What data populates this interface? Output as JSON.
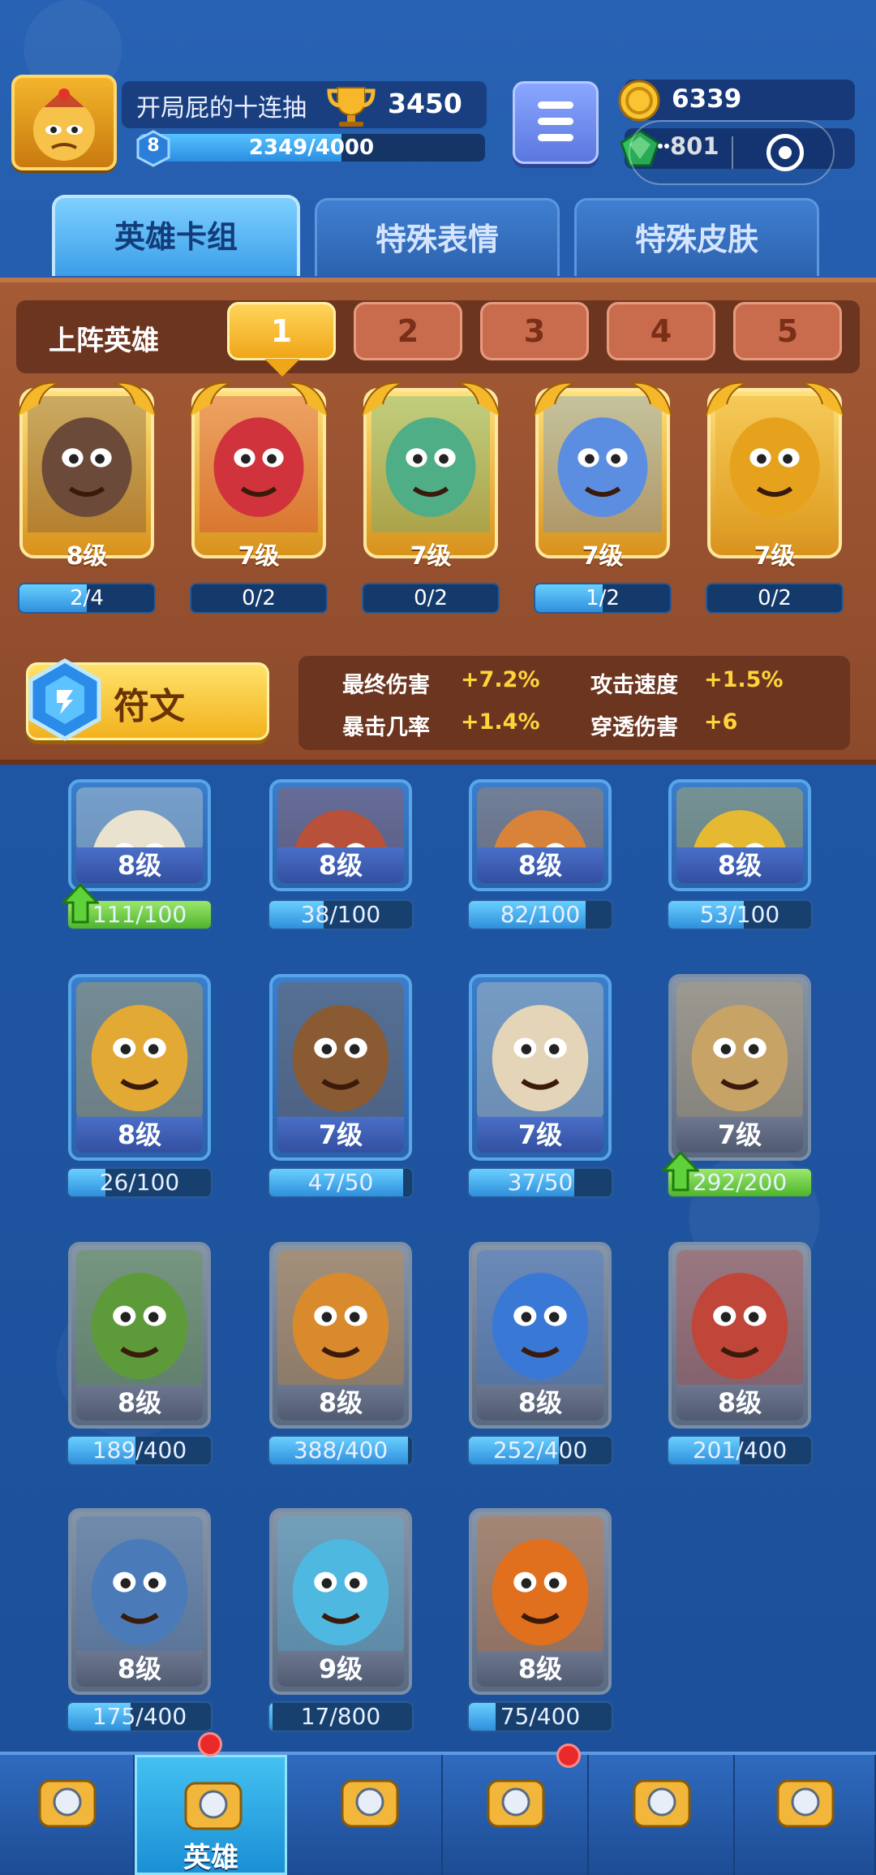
{
  "player": {
    "name": "开局屁的十连抽",
    "trophies": "3450",
    "level": "8",
    "xp_text": "2349/4000",
    "xp_fraction": 0.587
  },
  "currency": {
    "gold": "6339",
    "gems": "801"
  },
  "tabs": [
    {
      "label": "英雄卡组",
      "active": true
    },
    {
      "label": "特殊表情",
      "active": false
    },
    {
      "label": "特殊皮肤",
      "active": false
    }
  ],
  "deck": {
    "label": "上阵英雄",
    "slots": [
      "1",
      "2",
      "3",
      "4",
      "5"
    ],
    "active_slot": "1",
    "heroes": [
      {
        "level": "8级",
        "progress": "2/4",
        "fraction": 0.5,
        "icon": "lava-golem-hero",
        "color": "#6b4a3a"
      },
      {
        "level": "7级",
        "progress": "0/2",
        "fraction": 0.0,
        "icon": "red-bird-magician-hero",
        "color": "#d0333b"
      },
      {
        "level": "7级",
        "progress": "0/2",
        "fraction": 0.0,
        "icon": "frog-cowboy-hero",
        "color": "#4fae86"
      },
      {
        "level": "7级",
        "progress": "1/2",
        "fraction": 0.5,
        "icon": "ice-knight-hero",
        "color": "#5b8ee0"
      },
      {
        "level": "7级",
        "progress": "0/2",
        "fraction": 0.0,
        "icon": "golden-spartan-hero",
        "color": "#e6a21c"
      }
    ]
  },
  "rune": {
    "label": "符文"
  },
  "stats": [
    {
      "name": "最终伤害",
      "value": "+7.2%"
    },
    {
      "name": "攻击速度",
      "value": "+1.5%"
    },
    {
      "name": "暴击几率",
      "value": "+1.4%"
    },
    {
      "name": "穿透伤害",
      "value": "+6"
    }
  ],
  "collection": [
    {
      "level": "8级",
      "progress": "111/100",
      "fraction": 1.0,
      "upgrade": true,
      "dim": false,
      "icon": "mummy-hero",
      "color": "#e9e2cf"
    },
    {
      "level": "8级",
      "progress": "38/100",
      "fraction": 0.38,
      "upgrade": false,
      "dim": false,
      "icon": "bandit-hero",
      "color": "#b8503a"
    },
    {
      "level": "8级",
      "progress": "82/100",
      "fraction": 0.82,
      "upgrade": false,
      "dim": false,
      "icon": "chicken-leg-hero",
      "color": "#d9833a"
    },
    {
      "level": "8级",
      "progress": "53/100",
      "fraction": 0.53,
      "upgrade": false,
      "dim": false,
      "icon": "racer-hero",
      "color": "#e6b933"
    },
    {
      "level": "8级",
      "progress": "26/100",
      "fraction": 0.26,
      "upgrade": false,
      "dim": false,
      "icon": "golden-knight-hero",
      "color": "#e2a935"
    },
    {
      "level": "7级",
      "progress": "47/50",
      "fraction": 0.94,
      "upgrade": false,
      "dim": false,
      "icon": "bear-hero",
      "color": "#8a5a32"
    },
    {
      "level": "7级",
      "progress": "37/50",
      "fraction": 0.74,
      "upgrade": false,
      "dim": false,
      "icon": "panda-hero",
      "color": "#e4d4b8"
    },
    {
      "level": "7级",
      "progress": "292/200",
      "fraction": 1.0,
      "upgrade": true,
      "dim": true,
      "icon": "stone-boar-hero",
      "color": "#c7a466"
    },
    {
      "level": "8级",
      "progress": "189/400",
      "fraction": 0.47,
      "upgrade": false,
      "dim": true,
      "icon": "hooded-archer-hero",
      "color": "#5d9b3a"
    },
    {
      "level": "8级",
      "progress": "388/400",
      "fraction": 0.97,
      "upgrade": false,
      "dim": true,
      "icon": "tiki-mask-hero",
      "color": "#d98a2c"
    },
    {
      "level": "8级",
      "progress": "252/400",
      "fraction": 0.63,
      "upgrade": false,
      "dim": true,
      "icon": "blue-wizard-hero",
      "color": "#3a78d6"
    },
    {
      "level": "8级",
      "progress": "201/400",
      "fraction": 0.5,
      "upgrade": false,
      "dim": true,
      "icon": "aviator-hero",
      "color": "#c0463a"
    },
    {
      "level": "8级",
      "progress": "175/400",
      "fraction": 0.44,
      "upgrade": false,
      "dim": true,
      "icon": "detective-shark-hero",
      "color": "#4a7bb8"
    },
    {
      "level": "9级",
      "progress": "17/800",
      "fraction": 0.02,
      "upgrade": false,
      "dim": true,
      "icon": "miner-hero",
      "color": "#4fb8e0"
    },
    {
      "level": "8级",
      "progress": "75/400",
      "fraction": 0.19,
      "upgrade": false,
      "dim": true,
      "icon": "dwarf-gunner-hero",
      "color": "#e0701e"
    }
  ],
  "nav": [
    {
      "label": "",
      "icon": "treasure-chest-icon",
      "active": false,
      "badge": false
    },
    {
      "label": "英雄",
      "icon": "knight-helmet-icon",
      "active": true,
      "badge": true
    },
    {
      "label": "",
      "icon": "crossed-swords-icon",
      "active": false,
      "badge": false
    },
    {
      "label": "",
      "icon": "crown-shield-icon",
      "active": false,
      "badge": true
    },
    {
      "label": "",
      "icon": "guild-banner-icon",
      "active": false,
      "badge": false
    },
    {
      "label": "",
      "icon": "sprout-island-icon",
      "active": false,
      "badge": false
    }
  ]
}
